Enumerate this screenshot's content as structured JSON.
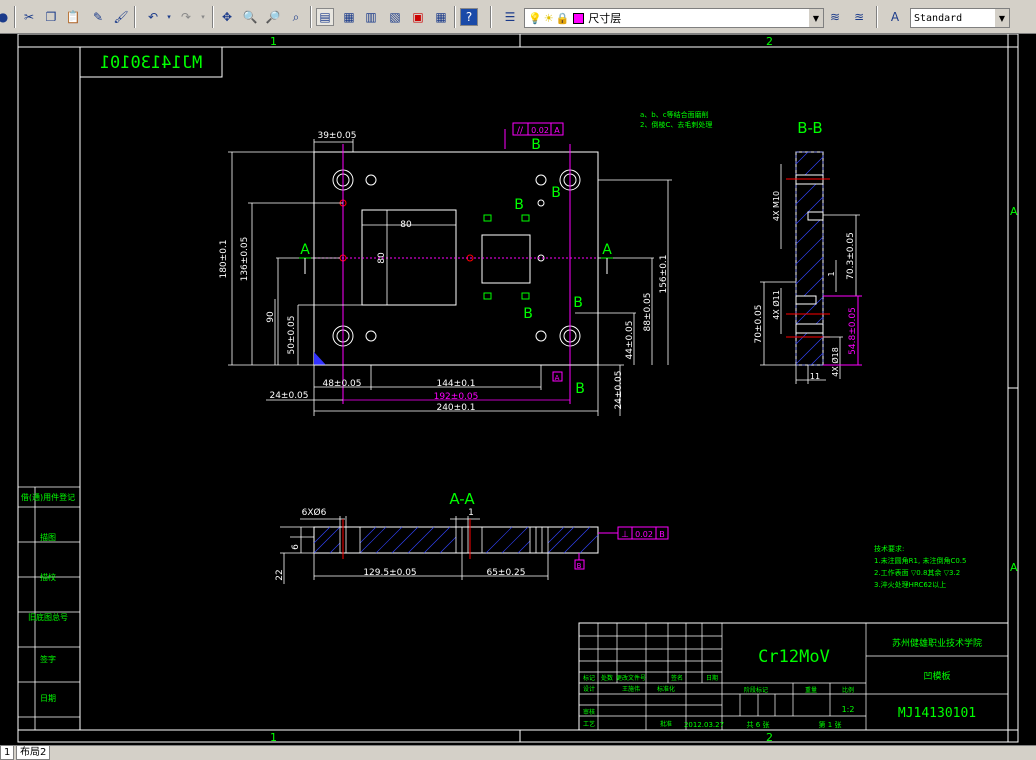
{
  "toolbar": {
    "layer_name": "尺寸层",
    "text_style": "Standard",
    "colors": {
      "layer_swatch": "#ff00ff"
    }
  },
  "tabs": [
    {
      "label": "1"
    },
    {
      "label": "布局2"
    }
  ],
  "zones": {
    "col1": "1",
    "col2": "2",
    "rowA": "A"
  },
  "drawing": {
    "part_number_mirrored": "MJ14130101",
    "notes_top": [
      "a、b、c等结合面磨削",
      "2、倒棱C、去毛刺处理"
    ],
    "section_bb": "B-B",
    "section_aa": "A-A",
    "label_A": "A",
    "label_B": "B",
    "dims_plan": {
      "d39": "39±0.05",
      "d180": "180±0.1",
      "d136": "136±0.05",
      "d90": "90",
      "d50": "50±0.05",
      "d48": "48±0.05",
      "d144": "144±0.1",
      "d192": "192±0.05",
      "d240": "240±0.1",
      "d24a": "24±0.05",
      "d24b": "24±0.05",
      "d156": "156±0.1",
      "d88": "88±0.05",
      "d44": "44±0.05",
      "d80a": "80",
      "d80b": "80",
      "flat_tol": "0.02",
      "datum_a": "A",
      "small_box": "A"
    },
    "dims_bb": {
      "d4x10": "4X M10",
      "d70_3": "70.3±0.05",
      "d70": "70±0.05",
      "d4x11": "4X Ø11",
      "d54_8": "54.8±0.05",
      "d11": "11",
      "d4x18": "4X Ø18",
      "d1": "1"
    },
    "dims_aa": {
      "d6x6": "6XØ6",
      "d1": "1",
      "d6": "6",
      "d22": "22",
      "d129": "129.5±0.05",
      "d65": "65±0.25",
      "perp_tol": "0.02",
      "datum_b": "B",
      "small_box": "B"
    },
    "tech_req": {
      "title": "技术要求:",
      "lines": [
        "1.未注圆角R1, 未注倒角C0.5",
        "2.工作表面  ▽0.8其余  ▽3.2",
        "3.淬火处理HRC62以上"
      ]
    },
    "title_block": {
      "material": "Cr12MoV",
      "school": "苏州健雄职业技术学院",
      "part_name": "凹模板",
      "drawing_no": "MJ14130101",
      "scale": "1:2",
      "date": "2012.03.27",
      "sheets": "共 6 张",
      "sheet_no": "第 1 张",
      "h_mark": "标记",
      "h_count": "处数",
      "h_zone": "更改文件号",
      "h_sign": "签名",
      "h_date": "日期",
      "h_design": "设计",
      "h_designer": "王施伟",
      "h_std": "标准化",
      "h_stage": "阶段标记",
      "h_weight": "重量",
      "h_ratio": "比例",
      "h_review": "审核",
      "h_craft": "工艺",
      "h_approve": "批准"
    },
    "side_block": {
      "s1": "借(通)用件登记",
      "s2": "旧底图总号",
      "s3": "描图",
      "s4": "描校",
      "s5": "底图总号",
      "s6": "签字",
      "s7": "日期"
    }
  }
}
